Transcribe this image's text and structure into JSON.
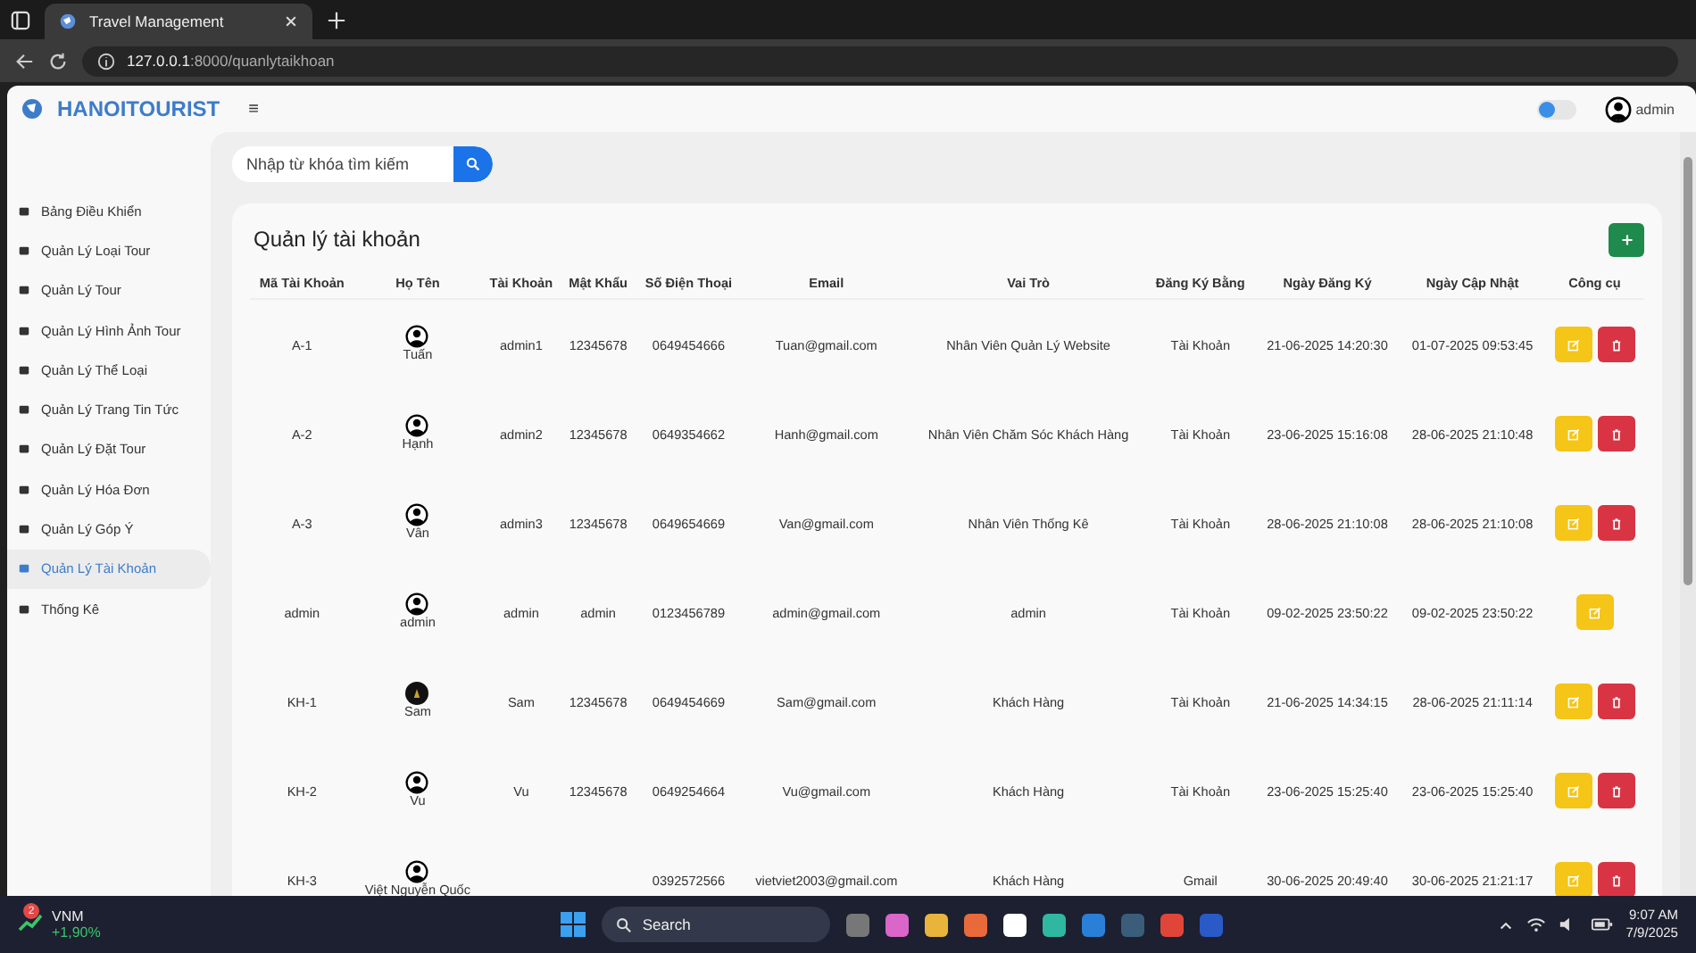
{
  "browser": {
    "tab_title": "Travel Management",
    "url_host": "127.0.0.1",
    "url_path": ":8000/quanlytaikhoan"
  },
  "topbar": {
    "brand": "HANOITOURIST",
    "menu_glyph": "≡",
    "theme_toggle": {
      "on": false
    },
    "user": "admin"
  },
  "search": {
    "placeholder": "Nhập từ khóa tìm kiếm"
  },
  "sidebar": {
    "items": [
      {
        "label": "Bảng Điều Khiển",
        "selected": false
      },
      {
        "label": "Quản Lý Loại Tour",
        "selected": false
      },
      {
        "label": "Quản Lý Tour",
        "selected": false
      },
      {
        "label": "Quản Lý Hình Ảnh Tour",
        "selected": false
      },
      {
        "label": "Quản Lý Thể Loại",
        "selected": false
      },
      {
        "label": "Quản Lý Trang Tin Tức",
        "selected": false
      },
      {
        "label": "Quản Lý Đặt Tour",
        "selected": false
      },
      {
        "label": "Quản Lý Hóa Đơn",
        "selected": false
      },
      {
        "label": "Quản Lý Góp Ý",
        "selected": false
      },
      {
        "label": "Quản Lý Tài Khoản",
        "selected": true
      },
      {
        "label": "Thống Kê",
        "selected": false
      }
    ]
  },
  "card": {
    "title": "Quản lý tài khoản"
  },
  "table": {
    "columns": [
      "Mã Tài Khoản",
      "Họ Tên",
      "Tài Khoản",
      "Mật Khẩu",
      "Số Điện Thoại",
      "Email",
      "Vai Trò",
      "Đăng Ký Bằng",
      "Ngày Đăng Ký",
      "Ngày Cập Nhật",
      "Công cụ"
    ],
    "rows": [
      {
        "id": "A-1",
        "name": "Tuấn",
        "kind": "default",
        "username": "admin1",
        "password": "12345678",
        "phone": "0649454666",
        "email": "Tuan@gmail.com",
        "role": "Nhân Viên Quản Lý Website",
        "via": "Tài Khoản",
        "created": "21-06-2025 14:20:30",
        "updated": "01-07-2025 09:53:45",
        "deletable": true
      },
      {
        "id": "A-2",
        "name": "Hạnh",
        "kind": "default",
        "username": "admin2",
        "password": "12345678",
        "phone": "0649354662",
        "email": "Hanh@gmail.com",
        "role": "Nhân Viên Chăm Sóc Khách Hàng",
        "via": "Tài Khoản",
        "created": "23-06-2025 15:16:08",
        "updated": "28-06-2025 21:10:48",
        "deletable": true
      },
      {
        "id": "A-3",
        "name": "Vân",
        "kind": "default",
        "username": "admin3",
        "password": "12345678",
        "phone": "0649654669",
        "email": "Van@gmail.com",
        "role": "Nhân Viên Thống Kê",
        "via": "Tài Khoản",
        "created": "28-06-2025 21:10:08",
        "updated": "28-06-2025 21:10:08",
        "deletable": true
      },
      {
        "id": "admin",
        "name": "admin",
        "kind": "default",
        "username": "admin",
        "password": "admin",
        "phone": "0123456789",
        "email": "admin@gmail.com",
        "role": "admin",
        "via": "Tài Khoản",
        "created": "09-02-2025 23:50:22",
        "updated": "09-02-2025 23:50:22",
        "deletable": false
      },
      {
        "id": "KH-1",
        "name": "Sam",
        "kind": "photo",
        "username": "Sam",
        "password": "12345678",
        "phone": "0649454669",
        "email": "Sam@gmail.com",
        "role": "Khách Hàng",
        "via": "Tài Khoản",
        "created": "21-06-2025 14:34:15",
        "updated": "28-06-2025 21:11:14",
        "deletable": true
      },
      {
        "id": "KH-2",
        "name": "Vu",
        "kind": "default",
        "username": "Vu",
        "password": "12345678",
        "phone": "0649254664",
        "email": "Vu@gmail.com",
        "role": "Khách Hàng",
        "via": "Tài Khoản",
        "created": "23-06-2025 15:25:40",
        "updated": "23-06-2025 15:25:40",
        "deletable": true
      },
      {
        "id": "KH-3",
        "name": "Việt Nguyễn Quốc",
        "kind": "default",
        "username": "",
        "password": "",
        "phone": "0392572566",
        "email": "vietviet2003@gmail.com",
        "role": "Khách Hàng",
        "via": "Gmail",
        "created": "30-06-2025 20:49:40",
        "updated": "30-06-2025 21:21:17",
        "deletable": true
      }
    ]
  },
  "taskbar": {
    "stock": {
      "symbol": "VNM",
      "change": "+1,90%",
      "badge": "2"
    },
    "search": "Search",
    "time": "9:07 AM",
    "date": "7/9/2025"
  }
}
